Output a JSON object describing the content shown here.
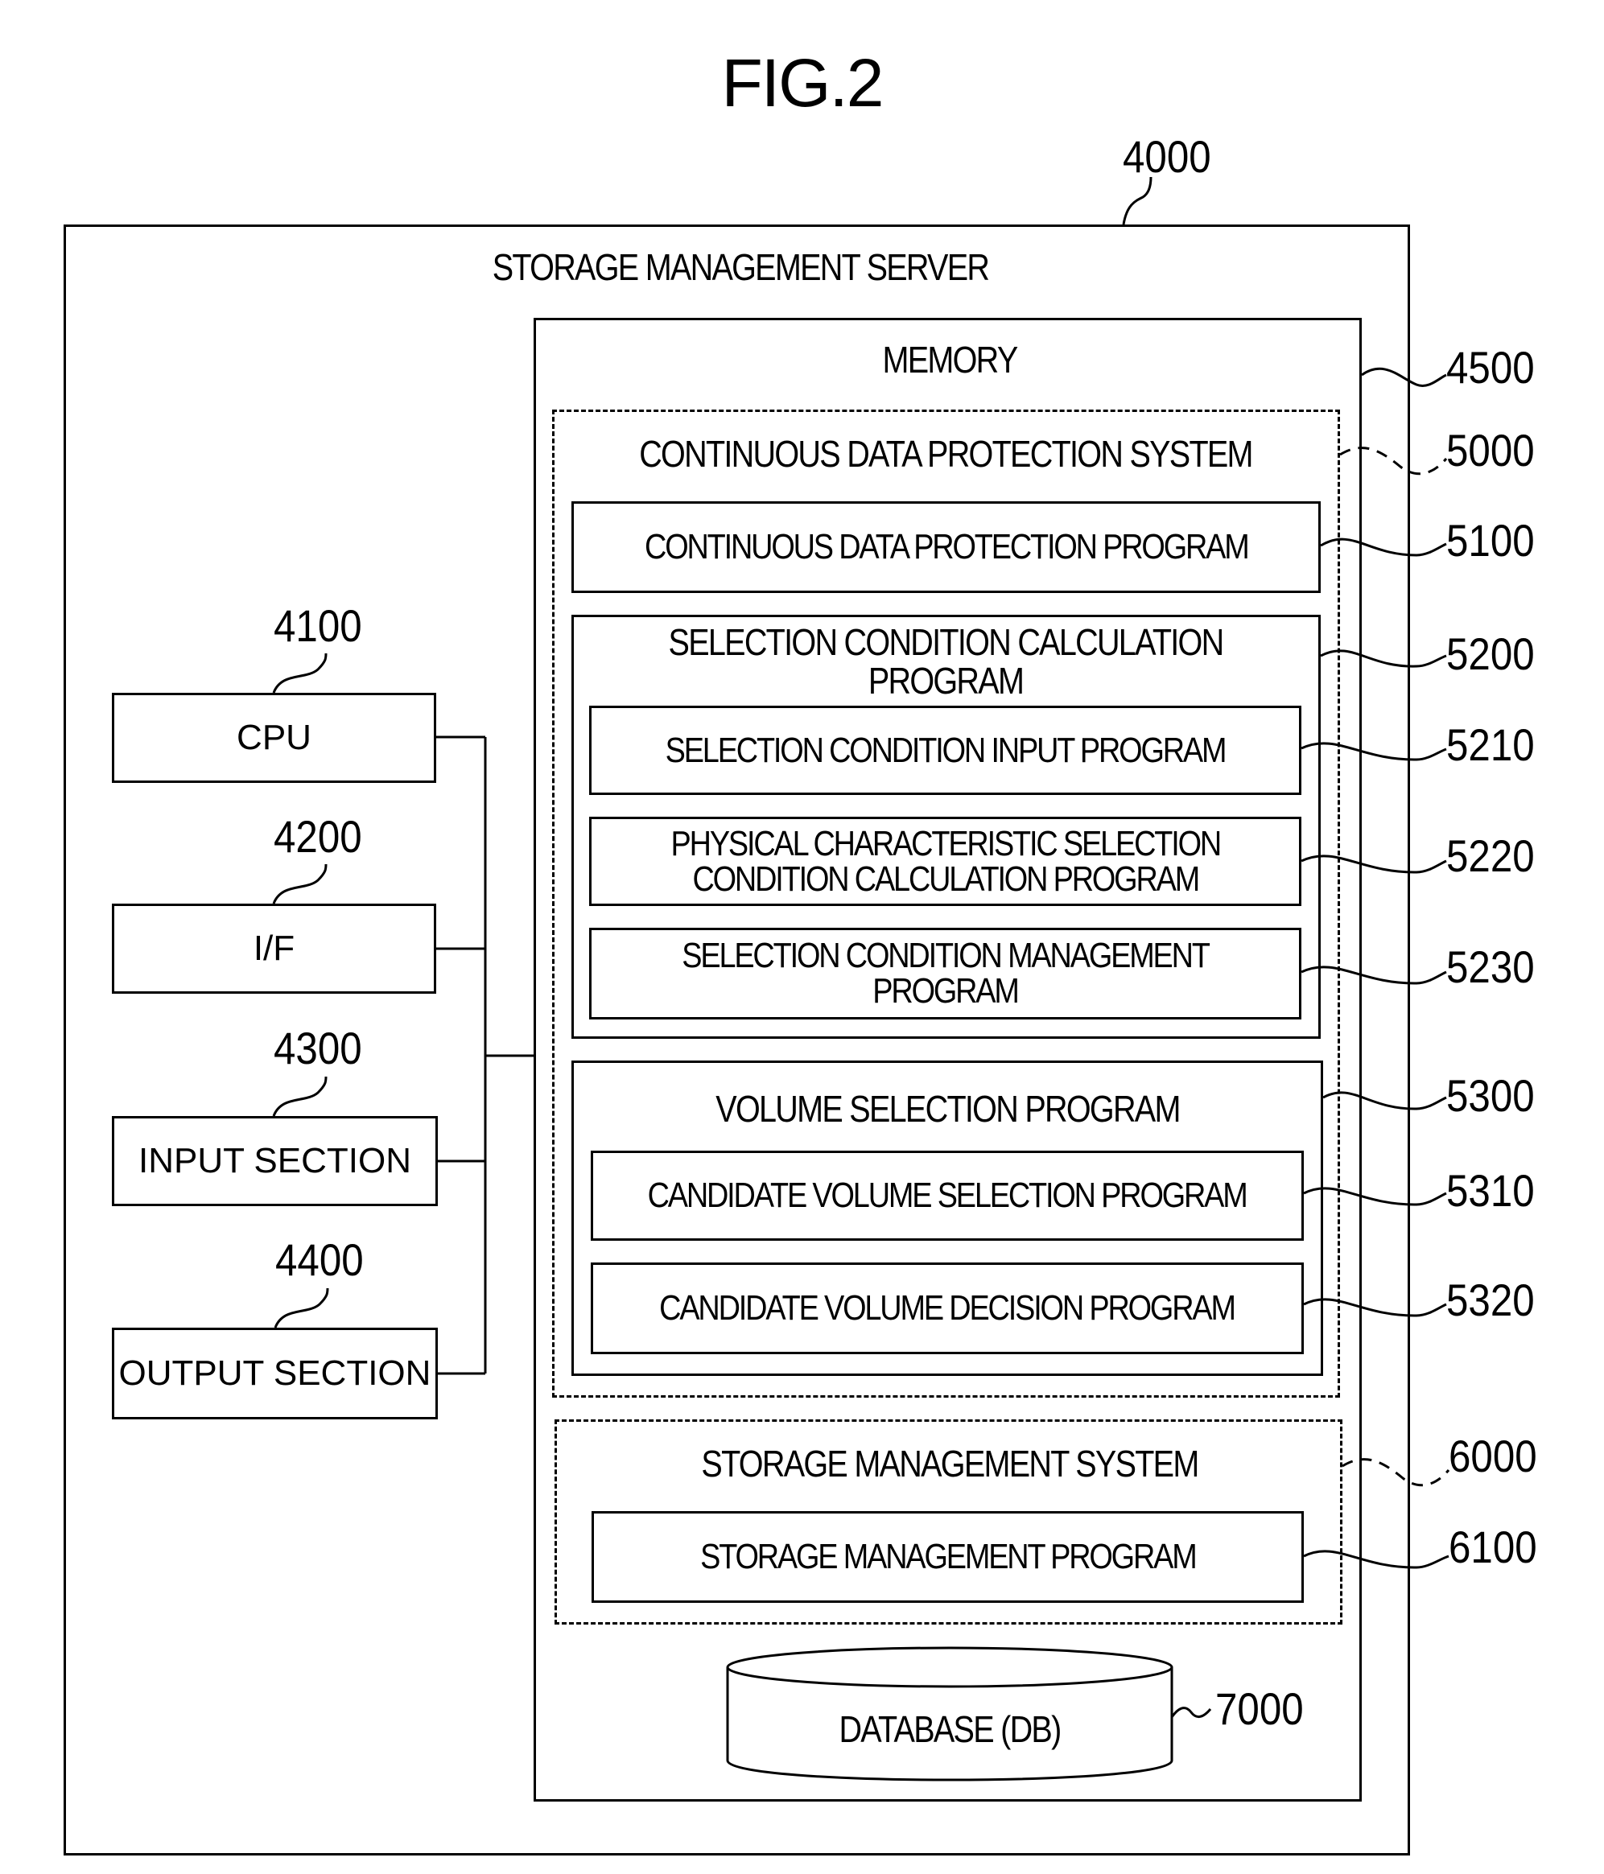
{
  "figure": {
    "title": "FIG.2"
  },
  "server": {
    "label": "STORAGE MANAGEMENT SERVER",
    "ref": "4000"
  },
  "hardware": [
    {
      "label": "CPU",
      "ref": "4100"
    },
    {
      "label": "I/F",
      "ref": "4200"
    },
    {
      "label": "INPUT SECTION",
      "ref": "4300"
    },
    {
      "label": "OUTPUT SECTION",
      "ref": "4400"
    }
  ],
  "memory": {
    "label": "MEMORY",
    "ref": "4500"
  },
  "cdp_system": {
    "label": "CONTINUOUS DATA PROTECTION SYSTEM",
    "ref": "5000",
    "cdp_program": {
      "label": "CONTINUOUS DATA PROTECTION PROGRAM",
      "ref": "5100"
    },
    "selection_calc": {
      "label": "SELECTION CONDITION CALCULATION\nPROGRAM",
      "ref": "5200",
      "children": [
        {
          "label": "SELECTION CONDITION INPUT PROGRAM",
          "ref": "5210"
        },
        {
          "label": "PHYSICAL CHARACTERISTIC SELECTION\nCONDITION CALCULATION PROGRAM",
          "ref": "5220"
        },
        {
          "label": "SELECTION CONDITION MANAGEMENT\nPROGRAM",
          "ref": "5230"
        }
      ]
    },
    "volume_selection": {
      "label": "VOLUME SELECTION PROGRAM",
      "ref": "5300",
      "children": [
        {
          "label": "CANDIDATE VOLUME SELECTION PROGRAM",
          "ref": "5310"
        },
        {
          "label": "CANDIDATE VOLUME DECISION PROGRAM",
          "ref": "5320"
        }
      ]
    }
  },
  "sm_system": {
    "label": "STORAGE MANAGEMENT SYSTEM",
    "ref": "6000",
    "program": {
      "label": "STORAGE MANAGEMENT PROGRAM",
      "ref": "6100"
    }
  },
  "database": {
    "label": "DATABASE (DB)",
    "ref": "7000"
  }
}
